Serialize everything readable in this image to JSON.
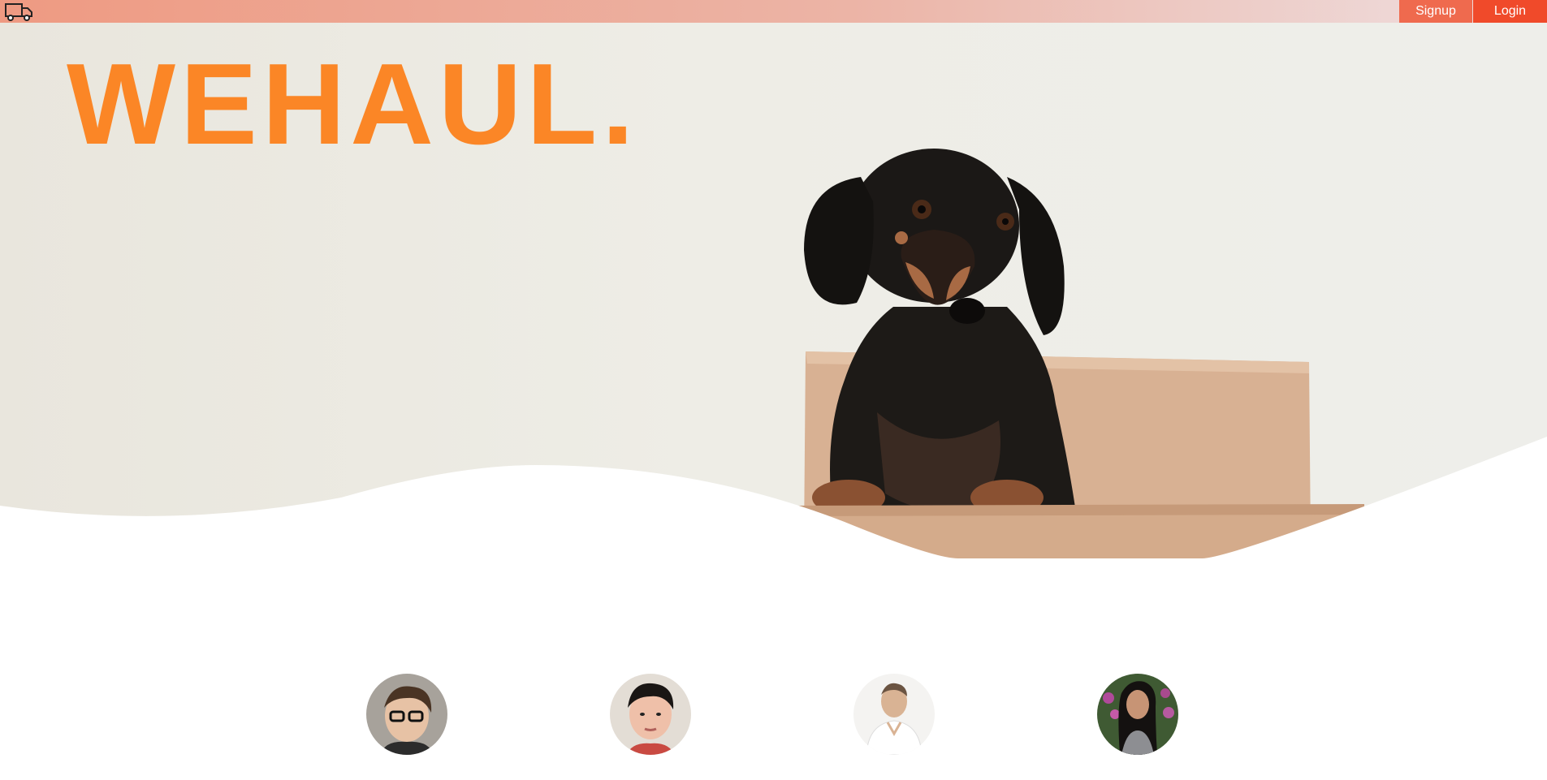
{
  "header": {
    "logo_icon": "truck-icon",
    "signup_label": "Signup",
    "login_label": "Login",
    "colors": {
      "signup": "#ef6a4e",
      "login": "#f04a2a"
    }
  },
  "hero": {
    "brand": "WEHAUL.",
    "brand_color": "#fb8626",
    "image": "dachshund-in-box-photo"
  },
  "team": {
    "members": [
      {
        "avatar": "team-member-1-photo"
      },
      {
        "avatar": "team-member-2-photo"
      },
      {
        "avatar": "team-member-3-photo"
      },
      {
        "avatar": "team-member-4-photo"
      }
    ]
  }
}
